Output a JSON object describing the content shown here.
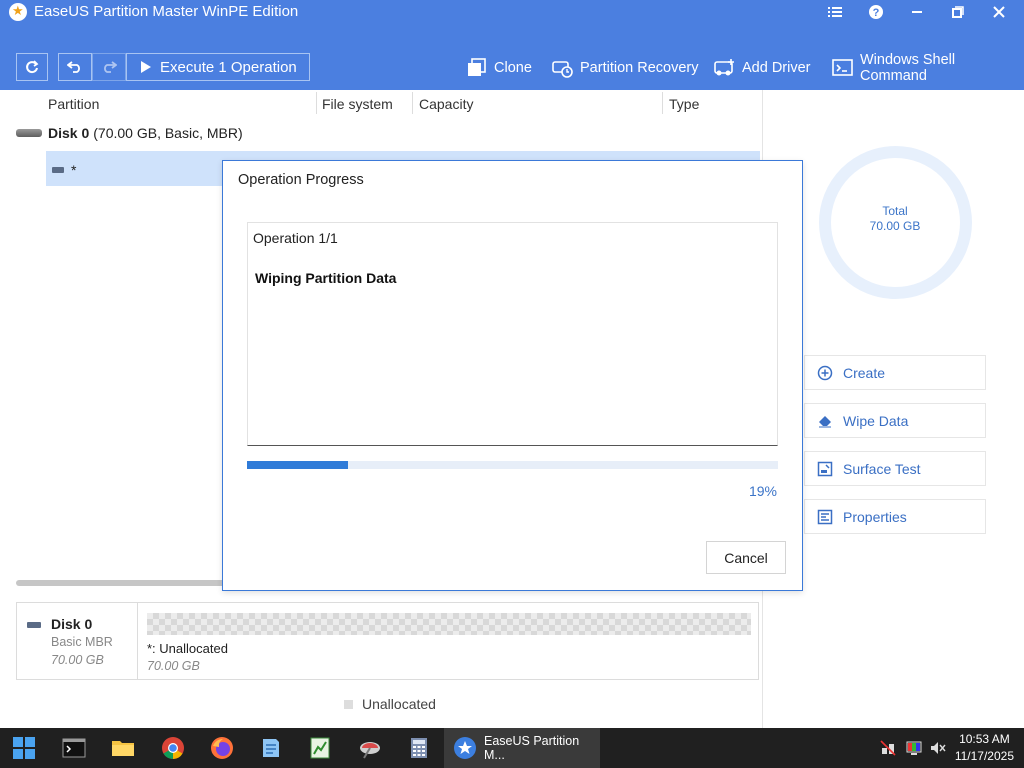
{
  "window": {
    "title": "EaseUS Partition Master WinPE Edition",
    "controls": [
      "menu-icon",
      "help-icon",
      "minimize-icon",
      "restore-icon",
      "close-icon"
    ]
  },
  "toolbar": {
    "execute_label": "Execute 1 Operation",
    "items": [
      {
        "name": "clone",
        "label": "Clone",
        "icon": "clone-icon"
      },
      {
        "name": "partition-recovery",
        "label": "Partition Recovery",
        "icon": "partition-recovery-icon"
      },
      {
        "name": "add-driver",
        "label": "Add Driver",
        "icon": "add-driver-icon"
      },
      {
        "name": "windows-shell-command",
        "label": "Windows Shell Command",
        "icon": "terminal-icon"
      }
    ]
  },
  "table": {
    "columns": [
      "Partition",
      "File system",
      "Capacity",
      "Type"
    ],
    "disk": {
      "name": "Disk 0",
      "detail": "(70.00 GB, Basic, MBR)"
    },
    "partition": {
      "name": "*"
    }
  },
  "disk_map": {
    "name": "Disk 0",
    "type": "Basic MBR",
    "size": "70.00 GB",
    "partition_label": "*: Unallocated",
    "partition_size": "70.00 GB"
  },
  "legend": {
    "label": "Unallocated"
  },
  "right_panel": {
    "total_label": "Total",
    "total_value": "70.00 GB",
    "actions": [
      {
        "name": "create",
        "label": "Create",
        "icon": "plus-circle-icon"
      },
      {
        "name": "wipe-data",
        "label": "Wipe Data",
        "icon": "eraser-icon"
      },
      {
        "name": "surface-test",
        "label": "Surface Test",
        "icon": "surface-test-icon"
      },
      {
        "name": "properties",
        "label": "Properties",
        "icon": "properties-icon"
      }
    ]
  },
  "dialog": {
    "title": "Operation Progress",
    "operation_count": "Operation 1/1",
    "task": "Wiping Partition Data",
    "progress": 0.19,
    "percent_label": "19%",
    "cancel_label": "Cancel"
  },
  "taskbar": {
    "active_app_label": "EaseUS Partition M...",
    "time": "10:53 AM",
    "date": "11/17/2025"
  },
  "colors": {
    "titlebar": "#4b7fe0",
    "accent": "#2f7bd8",
    "selection": "#cfe2fb",
    "taskbar": "#202020"
  }
}
